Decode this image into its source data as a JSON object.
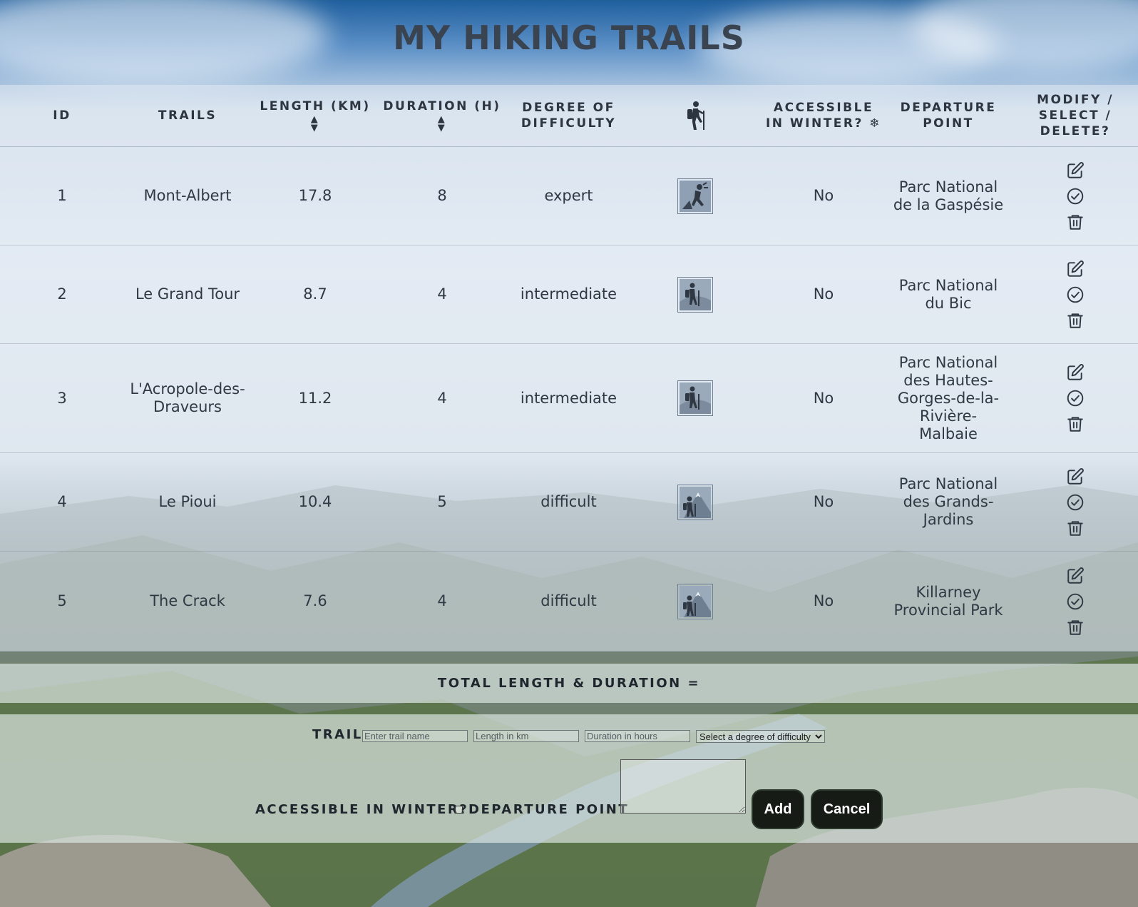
{
  "page": {
    "title": "MY HIKING TRAILS"
  },
  "table": {
    "headers": {
      "id": "ID",
      "trails": "TRAILS",
      "length": "LENGTH (KM)",
      "duration": "DURATION (H)",
      "difficulty_l1": "DEGREE OF",
      "difficulty_l2": "DIFFICULTY",
      "winter_l1": "ACCESSIBLE",
      "winter_l2": "IN WINTER? ❄",
      "departure_l1": "DEPARTURE",
      "departure_l2": "POINT",
      "actions_l1": "MODIFY /",
      "actions_l2": "SELECT /",
      "actions_l3": "DELETE?"
    },
    "header_icon": "hiker-icon",
    "rows": [
      {
        "id": "1",
        "trail": "Mont-Albert",
        "length": "17.8",
        "duration": "8",
        "difficulty": "expert",
        "difficulty_icon": "hiker-climbing-icon",
        "winter": "No",
        "departure": "Parc National de la Gaspésie"
      },
      {
        "id": "2",
        "trail": "Le Grand Tour",
        "length": "8.7",
        "duration": "4",
        "difficulty": "intermediate",
        "difficulty_icon": "hiker-hill-icon",
        "winter": "No",
        "departure": "Parc National du Bic"
      },
      {
        "id": "3",
        "trail": "L'Acropole-des-Draveurs",
        "length": "11.2",
        "duration": "4",
        "difficulty": "intermediate",
        "difficulty_icon": "hiker-hill-icon",
        "winter": "No",
        "departure": "Parc National des Hautes-Gorges-de-la-Rivière-Malbaie"
      },
      {
        "id": "4",
        "trail": "Le Pioui",
        "length": "10.4",
        "duration": "5",
        "difficulty": "difficult",
        "difficulty_icon": "hiker-mountain-icon",
        "winter": "No",
        "departure": "Parc National des Grands-Jardins"
      },
      {
        "id": "5",
        "trail": "The Crack",
        "length": "7.6",
        "duration": "4",
        "difficulty": "difficult",
        "difficulty_icon": "hiker-mountain-icon",
        "winter": "No",
        "departure": "Killarney Provincial Park"
      }
    ],
    "action_icons": [
      "edit-icon",
      "select-check-icon",
      "trash-icon"
    ]
  },
  "total": {
    "label": "TOTAL LENGTH & DURATION ="
  },
  "form": {
    "trail_label": "TRAIL",
    "trail_placeholder": "Enter trail name",
    "length_placeholder": "Length in km",
    "duration_placeholder": "Duration in hours",
    "difficulty_select": "Select a degree of difficulty",
    "winter_label": "ACCESSIBLE IN WINTER?",
    "departure_label": "DEPARTURE POINT",
    "add_label": "Add",
    "cancel_label": "Cancel"
  },
  "colors": {
    "title": "#3a4350",
    "header_text": "#2d3540",
    "button_bg": "#161b16"
  }
}
